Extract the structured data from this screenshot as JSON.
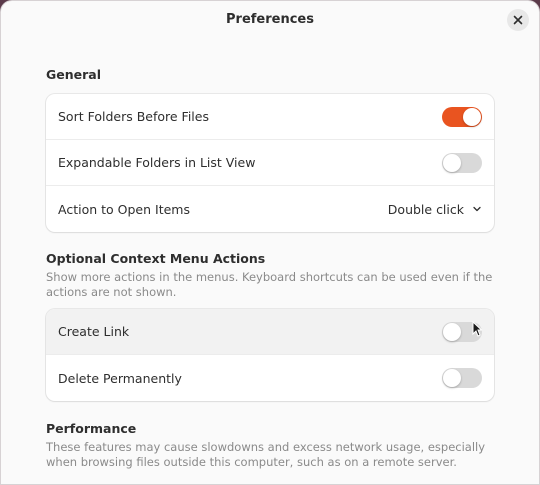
{
  "window": {
    "title": "Preferences"
  },
  "icons": {
    "close": "close-icon",
    "dropdown": "chevron-down-icon"
  },
  "colors": {
    "accent": "#e95420",
    "toggle_off": "#d9d9d9"
  },
  "general": {
    "title": "General",
    "rows": [
      {
        "label": "Sort Folders Before Files",
        "toggle": true
      },
      {
        "label": "Expandable Folders in List View",
        "toggle": false
      },
      {
        "label": "Action to Open Items",
        "value": "Double click"
      }
    ]
  },
  "context_menu": {
    "title": "Optional Context Menu Actions",
    "description": "Show more actions in the menus. Keyboard shortcuts can be used even if the actions are not shown.",
    "rows": [
      {
        "label": "Create Link",
        "toggle": false
      },
      {
        "label": "Delete Permanently",
        "toggle": false
      }
    ]
  },
  "performance": {
    "title": "Performance",
    "description": "These features may cause slowdowns and excess network usage, especially when browsing files outside this computer, such as on a remote server."
  }
}
